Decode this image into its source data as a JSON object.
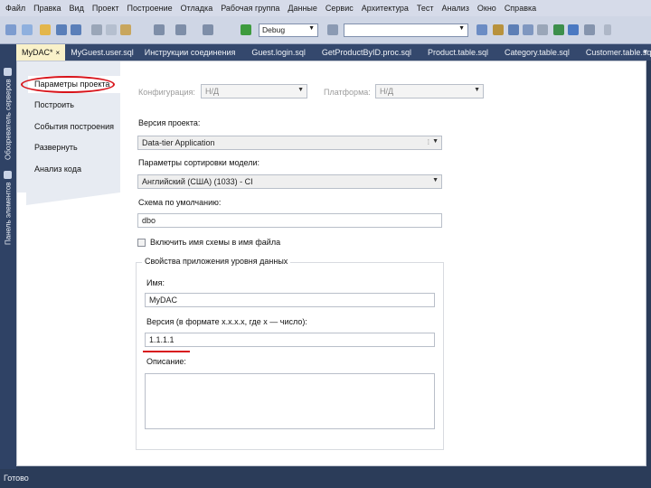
{
  "menu": [
    "Файл",
    "Правка",
    "Вид",
    "Проект",
    "Построение",
    "Отладка",
    "Рабочая группа",
    "Данные",
    "Сервис",
    "Архитектура",
    "Тест",
    "Анализ",
    "Окно",
    "Справка"
  ],
  "toolbar": {
    "config_value": "Debug",
    "search_value": ""
  },
  "left_strip": [
    "Обозреватель серверов",
    "Панель элементов"
  ],
  "doc_tabs": [
    {
      "label": "MyDAC*",
      "close": "×"
    },
    {
      "label": "MyGuest.user.sql"
    },
    {
      "label": "Инструкции соединения"
    },
    {
      "label": "Guest.login.sql"
    },
    {
      "label": "GetProductByID.proc.sql"
    },
    {
      "label": "Product.table.sql"
    },
    {
      "label": "Category.table.sql"
    },
    {
      "label": "Customer.table.sql"
    }
  ],
  "nav": [
    "Параметры проекта",
    "Построить",
    "События построения",
    "Развернуть",
    "Анализ кода"
  ],
  "form": {
    "configuration_label": "Конфигурация:",
    "configuration_value": "Н/Д",
    "platform_label": "Платформа:",
    "platform_value": "Н/Д",
    "project_version_label": "Версия проекта:",
    "project_version_value": "Data-tier Application",
    "collation_label": "Параметры сортировки модели:",
    "collation_value": "Английский (США) (1033) - CI",
    "default_schema_label": "Схема по умолчанию:",
    "default_schema_value": "dbo",
    "include_schema_label": "Включить имя схемы в имя файла",
    "include_schema_checked": false,
    "dac_group_label": "Свойства приложения уровня данных",
    "name_label": "Имя:",
    "name_value": "MyDAC",
    "version_label": "Версия (в формате x.x.x.x, где x — число):",
    "version_value": "1.1.1.1",
    "description_label": "Описание:",
    "description_value": ""
  },
  "status": "Готово",
  "colors": {
    "accent_red": "#d8141b",
    "active_tab": "#f9f1c9",
    "chrome_dark": "#2b3c59"
  }
}
